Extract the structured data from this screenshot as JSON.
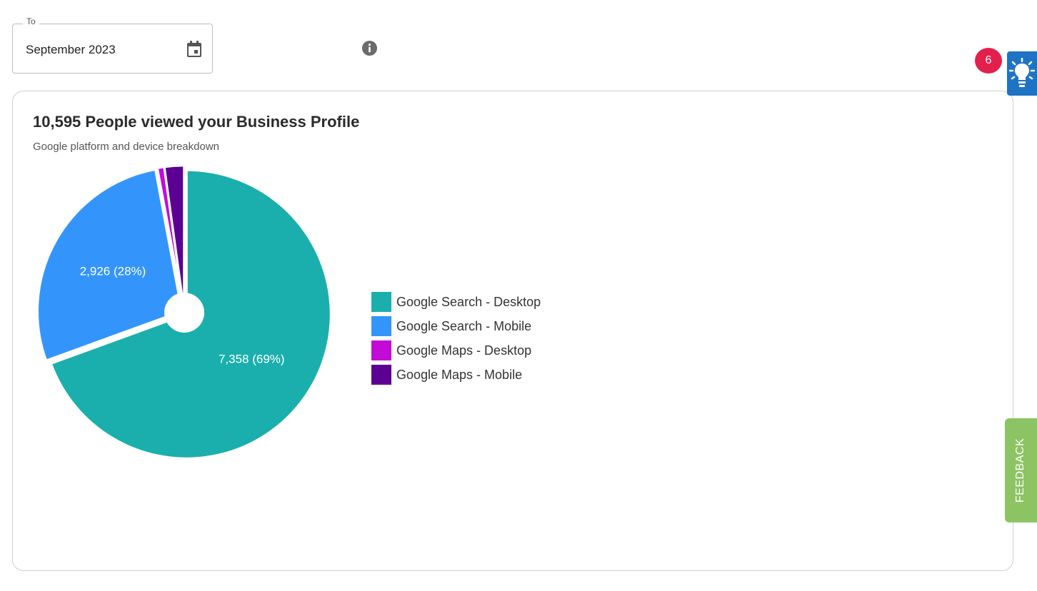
{
  "date_filter": {
    "label": "To",
    "value": "September 2023"
  },
  "card": {
    "title": "10,595 People viewed your Business Profile",
    "subtitle": "Google platform and device breakdown"
  },
  "chart_data": {
    "type": "pie",
    "title": "10,595 People viewed your Business Profile",
    "subtitle": "Google platform and device breakdown",
    "legend_position": "right",
    "slices": [
      {
        "name": "Google Search - Desktop",
        "value": 7358,
        "label": "7,358 (69%)",
        "color": "#1aafac"
      },
      {
        "name": "Google Search - Mobile",
        "value": 2926,
        "label": "2,926 (28%)",
        "color": "#3395fb"
      },
      {
        "name": "Google Maps - Desktop",
        "value": 80,
        "label": "",
        "color": "#c20bd6"
      },
      {
        "name": "Google Maps - Mobile",
        "value": 231,
        "label": "",
        "color": "#5b0093"
      }
    ]
  },
  "notifications": {
    "count": "6",
    "badge_color": "#e3204d"
  },
  "feedback": {
    "label": "FEEDBACK",
    "color": "#8dc463"
  },
  "icons": {
    "calendar": "calendar-icon",
    "info": "info-icon",
    "lightbulb": "lightbulb-icon"
  }
}
